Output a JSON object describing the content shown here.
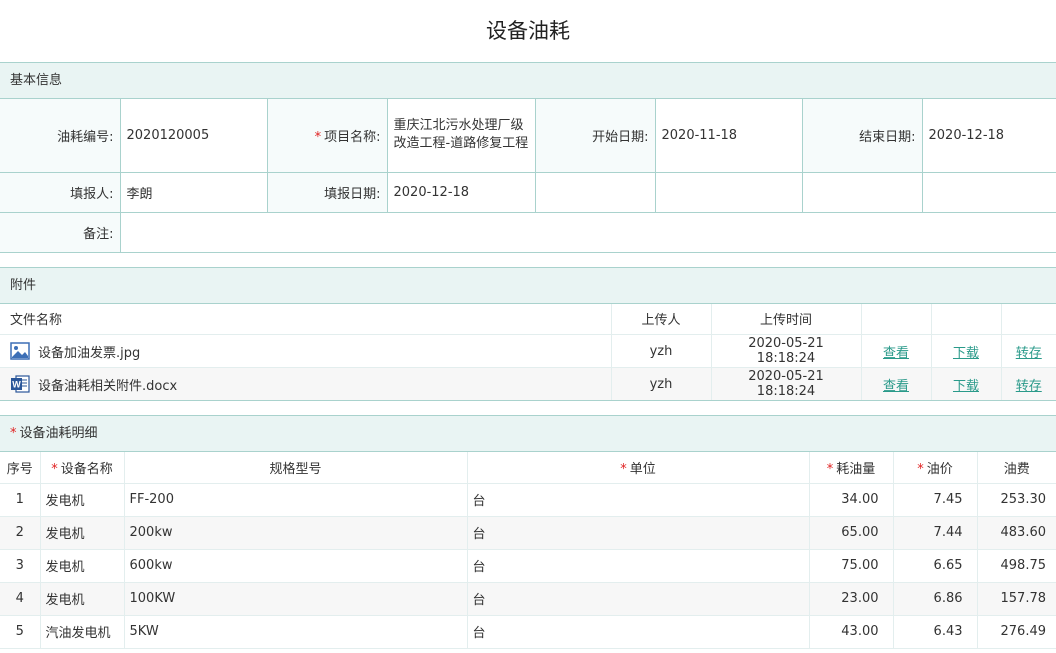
{
  "page": {
    "title": "设备油耗"
  },
  "basic": {
    "header": "基本信息",
    "labels": {
      "code": "油耗编号:",
      "project": "项目名称:",
      "start": "开始日期:",
      "end": "结束日期:",
      "reporter": "填报人:",
      "report_date": "填报日期:",
      "remark": "备注:"
    },
    "values": {
      "code": "2020120005",
      "project": "重庆江北污水处理厂级改造工程-道路修复工程",
      "start": "2020-11-18",
      "end": "2020-12-18",
      "reporter": "李朗",
      "report_date": "2020-12-18",
      "remark": ""
    }
  },
  "attachments": {
    "header": "附件",
    "columns": {
      "name": "文件名称",
      "uploader": "上传人",
      "time": "上传时间"
    },
    "rows": [
      {
        "icon": "image-file-icon",
        "name": "设备加油发票.jpg",
        "uploader": "yzh",
        "time": "2020-05-21 18:18:24",
        "view": "查看",
        "download": "下载",
        "save": "转存"
      },
      {
        "icon": "word-file-icon",
        "name": "设备油耗相关附件.docx",
        "uploader": "yzh",
        "time": "2020-05-21 18:18:24",
        "view": "查看",
        "download": "下载",
        "save": "转存"
      }
    ]
  },
  "detail": {
    "header": "设备油耗明细",
    "columns": {
      "no": "序号",
      "name": "设备名称",
      "spec": "规格型号",
      "unit": "单位",
      "qty": "耗油量",
      "price": "油价",
      "cost": "油费"
    },
    "rows": [
      {
        "no": "1",
        "name": "发电机",
        "spec": "FF-200",
        "unit": "台",
        "qty": "34.00",
        "price": "7.45",
        "cost": "253.30"
      },
      {
        "no": "2",
        "name": "发电机",
        "spec": "200kw",
        "unit": "台",
        "qty": "65.00",
        "price": "7.44",
        "cost": "483.60"
      },
      {
        "no": "3",
        "name": "发电机",
        "spec": "600kw",
        "unit": "台",
        "qty": "75.00",
        "price": "6.65",
        "cost": "498.75"
      },
      {
        "no": "4",
        "name": "发电机",
        "spec": "100KW",
        "unit": "台",
        "qty": "23.00",
        "price": "6.86",
        "cost": "157.78"
      },
      {
        "no": "5",
        "name": "汽油发电机",
        "spec": "5KW",
        "unit": "台",
        "qty": "43.00",
        "price": "6.43",
        "cost": "276.49"
      }
    ]
  },
  "colors": {
    "accent": "#2a9a8a",
    "header_bg": "#e9f4f3",
    "border": "#a9d2cd",
    "required": "#e02020"
  }
}
